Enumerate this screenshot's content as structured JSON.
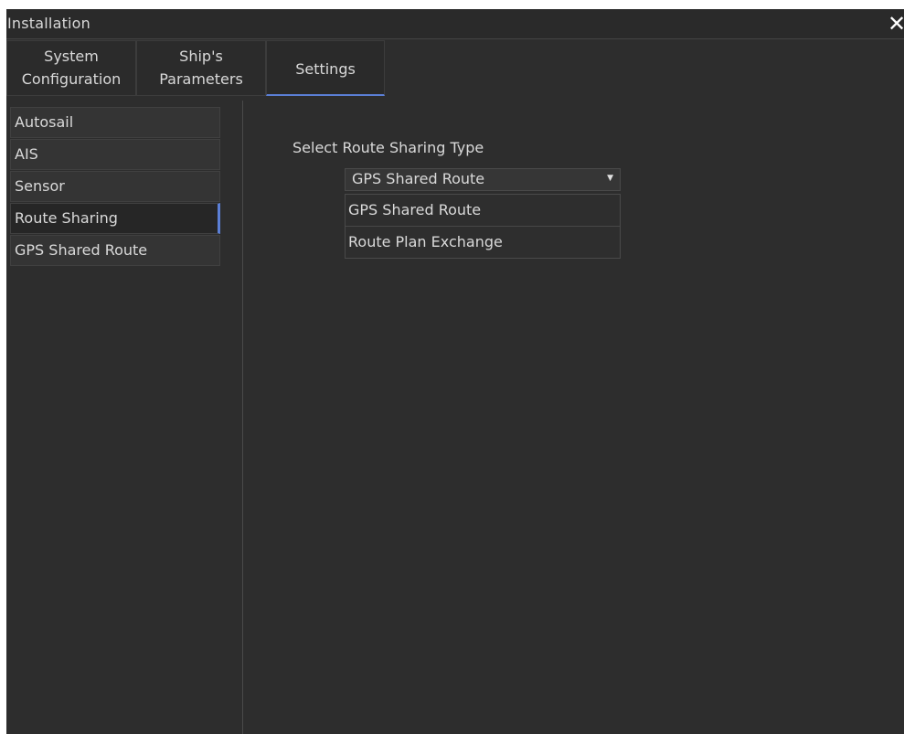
{
  "window": {
    "title": "Installation",
    "close_glyph": "✕"
  },
  "tabs": [
    {
      "line1": "System",
      "line2": "Configuration"
    },
    {
      "line1": "Ship's",
      "line2": "Parameters"
    },
    {
      "label": "Settings",
      "active": true
    }
  ],
  "sidebar": {
    "items": [
      {
        "label": "Autosail"
      },
      {
        "label": "AIS"
      },
      {
        "label": "Sensor"
      },
      {
        "label": "Route Sharing",
        "active": true
      },
      {
        "label": "GPS Shared Route"
      }
    ]
  },
  "main": {
    "route_sharing_label": "Select Route Sharing Type",
    "select_value": "GPS Shared Route",
    "caret_icon": "caret-down-icon",
    "options": [
      "GPS Shared Route",
      "Route Plan Exchange"
    ]
  },
  "colors": {
    "background": "#2d2d2d",
    "text": "#d9d9d9",
    "accent": "#5b7fd6"
  }
}
